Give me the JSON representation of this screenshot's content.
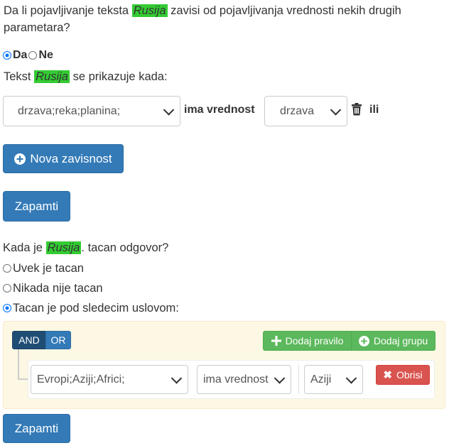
{
  "question1": {
    "prefix": "Da li pojavljivanje teksta",
    "highlight": "Rusija",
    "suffix": "zavisi od pojavljivanja vrednosti nekih drugih parametara?",
    "options": [
      {
        "label": "Da",
        "checked": true
      },
      {
        "label": "Ne",
        "checked": false
      }
    ]
  },
  "dependency": {
    "prefix": "Tekst",
    "highlight": "Rusija",
    "suffix": "se prikazuje kada:",
    "param_value": "drzava;reka;planina;",
    "has_value_label": "ima vrednost",
    "value_select": "drzava",
    "delete_icon": "trash-icon",
    "or_label": "ili",
    "add_button": "Nova zavisnost",
    "add_icon": "plus-circle-icon"
  },
  "save_label_1": "Zapamti",
  "question2": {
    "prefix": "Kada je",
    "highlight": "Rusija",
    "suffix": ". tacan odgovor?",
    "options": [
      {
        "label": "Uvek je tacan",
        "checked": false
      },
      {
        "label": "Nikada nije tacan",
        "checked": false
      },
      {
        "label": "Tacan je pod sledecim uslovom:",
        "checked": true
      }
    ]
  },
  "query_builder": {
    "and_label": "AND",
    "or_label": "OR",
    "add_rule": "Dodaj pravilo",
    "add_group": "Dodaj grupu",
    "rule": {
      "field": "Evropi;Aziji;Africi;",
      "operator": "ima vrednost",
      "value": "Aziji",
      "delete_label": "Obrisi"
    }
  },
  "save_label_2": "Zapamti",
  "colors": {
    "highlight": "#33cc33",
    "primary": "#337ab7",
    "success": "#5cb85c",
    "danger": "#d9534f",
    "panel_bg": "#fcf8e3"
  }
}
